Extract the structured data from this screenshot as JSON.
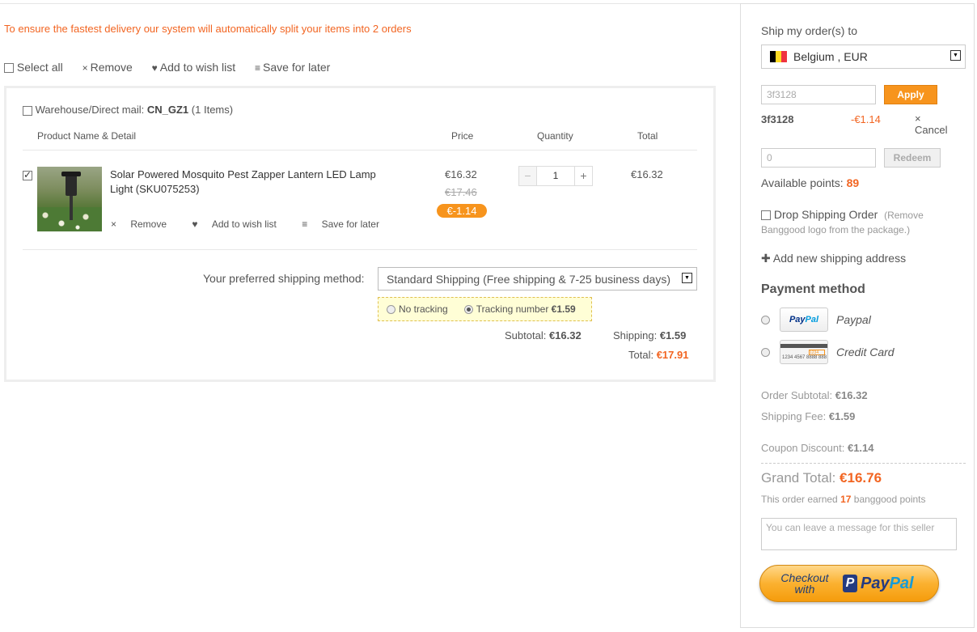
{
  "notice": "To ensure the fastest delivery our system will automatically split your items into 2 orders",
  "toolbar": {
    "select_all": "Select all",
    "remove": "Remove",
    "add_wish": "Add to wish list",
    "save_later": "Save for later"
  },
  "warehouse": {
    "label": "Warehouse/Direct mail:",
    "code": "CN_GZ1",
    "count": "(1 Items)"
  },
  "table_headers": {
    "product": "Product Name & Detail",
    "price": "Price",
    "quantity": "Quantity",
    "total": "Total"
  },
  "item": {
    "name": "Solar Powered Mosquito Pest Zapper Lantern LED Lamp Light (SKU075253)",
    "price": "€16.32",
    "old_price": "€17.46",
    "discount": "€-1.14",
    "quantity": "1",
    "total": "€16.32",
    "actions": {
      "remove": "Remove",
      "add_wish": "Add to wish list",
      "save_later": "Save for later"
    }
  },
  "shipping": {
    "label": "Your preferred shipping method:",
    "selected": "Standard Shipping (Free shipping & 7-25 business days)",
    "no_tracking": "No tracking",
    "tracking_label": "Tracking number",
    "tracking_price": "€1.59"
  },
  "summary": {
    "subtotal_label": "Subtotal:",
    "subtotal": "€16.32",
    "shipping_label": "Shipping:",
    "shipping": "€1.59",
    "total_label": "Total:",
    "total": "€17.91"
  },
  "panel": {
    "ship_to_label": "Ship my order(s) to",
    "country": "Belgium , EUR",
    "coupon_input": "3f3128",
    "apply": "Apply",
    "coupon_code": "3f3128",
    "coupon_amount": "-€1.14",
    "cancel": "Cancel",
    "points_input": "0",
    "redeem": "Redeem",
    "points_label": "Available points:",
    "points_value": "89",
    "dropship_label": "Drop Shipping Order",
    "dropship_note": "(Remove Banggood logo from the package.)",
    "add_address": "Add new shipping address",
    "payment_title": "Payment method",
    "pay_paypal": "Paypal",
    "pay_credit": "Credit Card",
    "cc_digits_box": "1234",
    "cc_number": "1234 4567 8888 888",
    "order_subtotal_label": "Order Subtotal:",
    "order_subtotal": "€16.32",
    "shipping_fee_label": "Shipping Fee:",
    "shipping_fee": "€1.59",
    "coupon_discount_label": "Coupon Discount:",
    "coupon_discount": "€1.14",
    "grand_total_label": "Grand Total:",
    "grand_total": "€16.76",
    "earned_pre": "This order earned",
    "earned_points": "17",
    "earned_post": "banggood points",
    "message_placeholder": "You can leave a message for this seller",
    "checkout_line1": "Checkout",
    "checkout_line2": "with",
    "paypal_p1": "Pay",
    "paypal_p2": "Pal"
  },
  "colors": {
    "accent": "#f26522",
    "button_orange": "#f7941d"
  }
}
